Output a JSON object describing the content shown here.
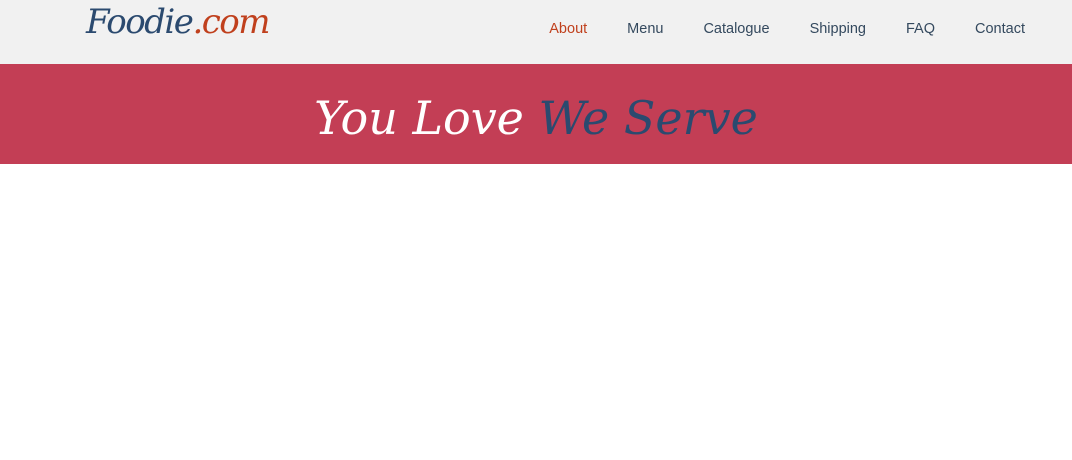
{
  "header": {
    "logo": {
      "main": "Foodie",
      "tld": ".com"
    },
    "nav": [
      {
        "label": "About",
        "active": true
      },
      {
        "label": "Menu",
        "active": false
      },
      {
        "label": "Catalogue",
        "active": false
      },
      {
        "label": "Shipping",
        "active": false
      },
      {
        "label": "FAQ",
        "active": false
      },
      {
        "label": "Contact",
        "active": false
      }
    ]
  },
  "banner": {
    "tagline_part1": "You Love",
    "tagline_part2": "We Serve"
  },
  "colors": {
    "brand_blue": "#2b4a6f",
    "brand_orange": "#c0401d",
    "banner_red": "#c33e55",
    "header_bg": "#f1f1f1",
    "nav_text": "#34495e"
  }
}
